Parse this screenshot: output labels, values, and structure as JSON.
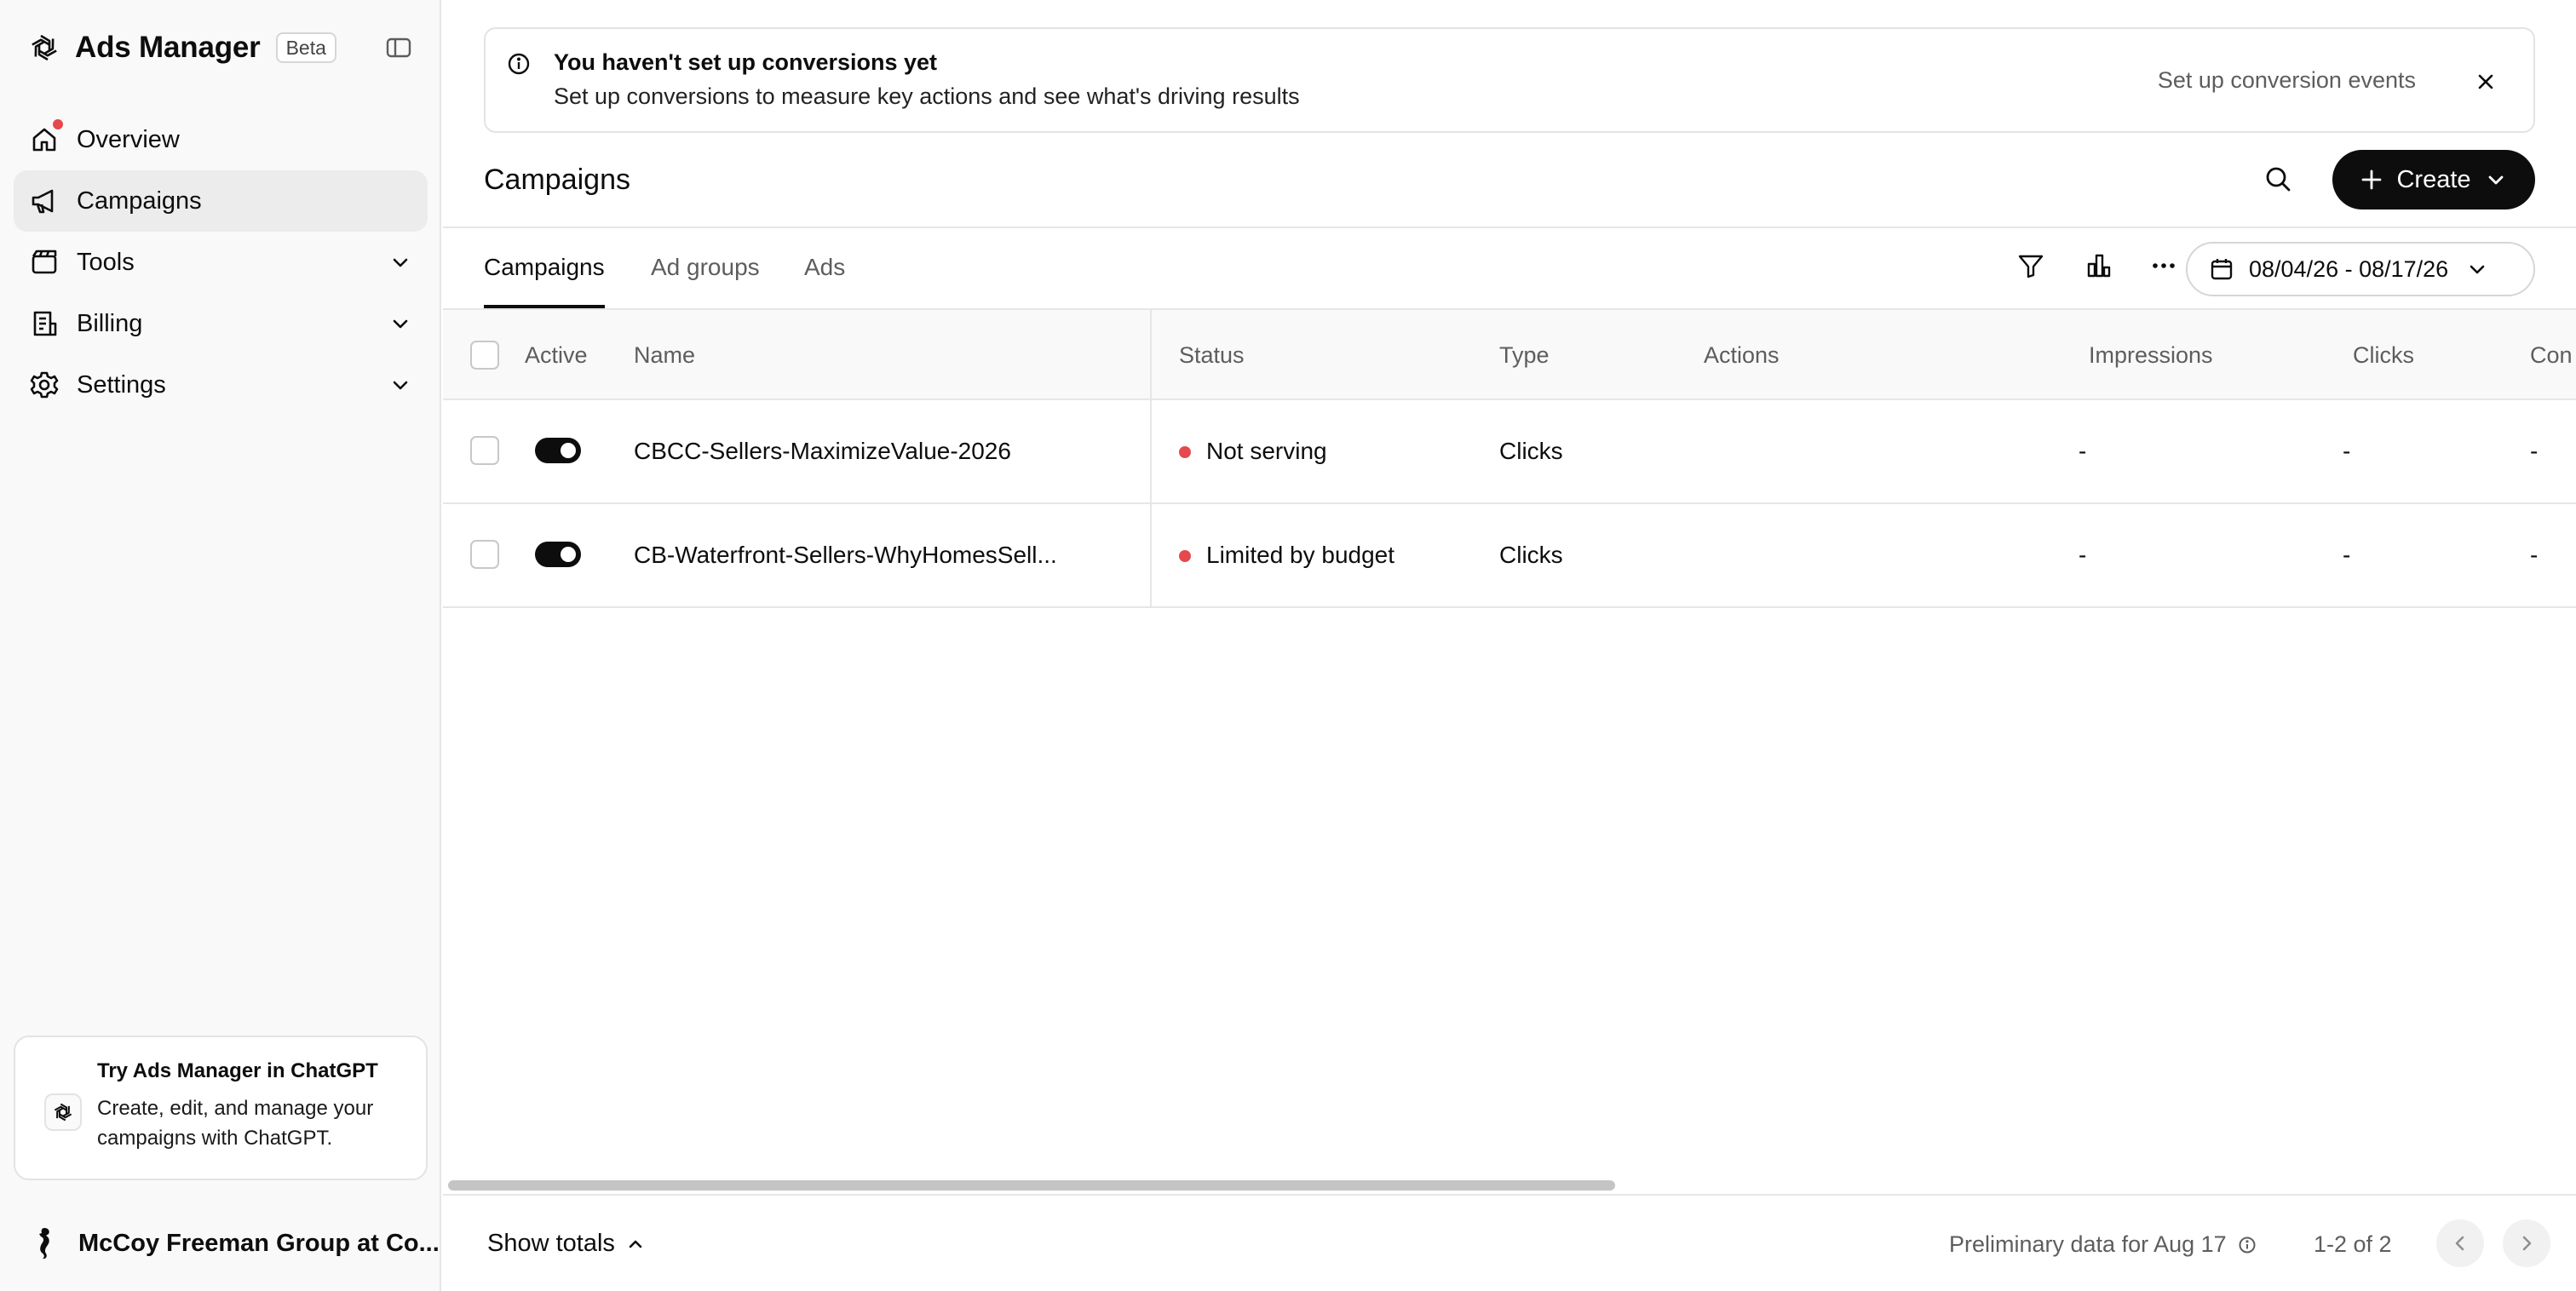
{
  "app": {
    "title": "Ads Manager",
    "badge": "Beta"
  },
  "sidebar": {
    "items": [
      {
        "label": "Overview",
        "icon": "home-icon",
        "active": false,
        "has_notification": true
      },
      {
        "label": "Campaigns",
        "icon": "megaphone-icon",
        "active": true
      },
      {
        "label": "Tools",
        "icon": "tools-icon",
        "expandable": true
      },
      {
        "label": "Billing",
        "icon": "receipt-icon",
        "expandable": true
      },
      {
        "label": "Settings",
        "icon": "gear-icon",
        "expandable": true
      }
    ],
    "promo": {
      "title": "Try Ads Manager in ChatGPT",
      "text": "Create, edit, and manage your campaigns with ChatGPT."
    },
    "account": {
      "name": "McCoy Freeman Group at Co..."
    }
  },
  "banner": {
    "title": "You haven't set up conversions yet",
    "text": "Set up conversions to measure key actions and see what's driving results",
    "link": "Set up conversion events"
  },
  "page": {
    "title": "Campaigns",
    "create_label": "Create"
  },
  "tabs": [
    {
      "label": "Campaigns",
      "active": true
    },
    {
      "label": "Ad groups",
      "active": false
    },
    {
      "label": "Ads",
      "active": false
    }
  ],
  "date_range": "08/04/26 - 08/17/26",
  "table": {
    "columns": [
      "Active",
      "Name",
      "Status",
      "Type",
      "Actions",
      "Impressions",
      "Clicks",
      "Con"
    ],
    "rows": [
      {
        "active": true,
        "name": "CBCC-Sellers-MaximizeValue-2026",
        "status": "Not serving",
        "type": "Clicks",
        "actions": "",
        "impressions": "-",
        "clicks": "-",
        "conversions": "-"
      },
      {
        "active": true,
        "name": "CB-Waterfront-Sellers-WhyHomesSell...",
        "status": "Limited by budget",
        "type": "Clicks",
        "actions": "",
        "impressions": "-",
        "clicks": "-",
        "conversions": "-"
      }
    ]
  },
  "footer": {
    "show_totals": "Show totals",
    "preliminary": "Preliminary data for Aug 17",
    "pagination": "1-2 of 2"
  },
  "colors": {
    "accent": "#0d0d0d",
    "status_dot": "#e5484d",
    "sidebar_bg": "#f9f9f9"
  }
}
